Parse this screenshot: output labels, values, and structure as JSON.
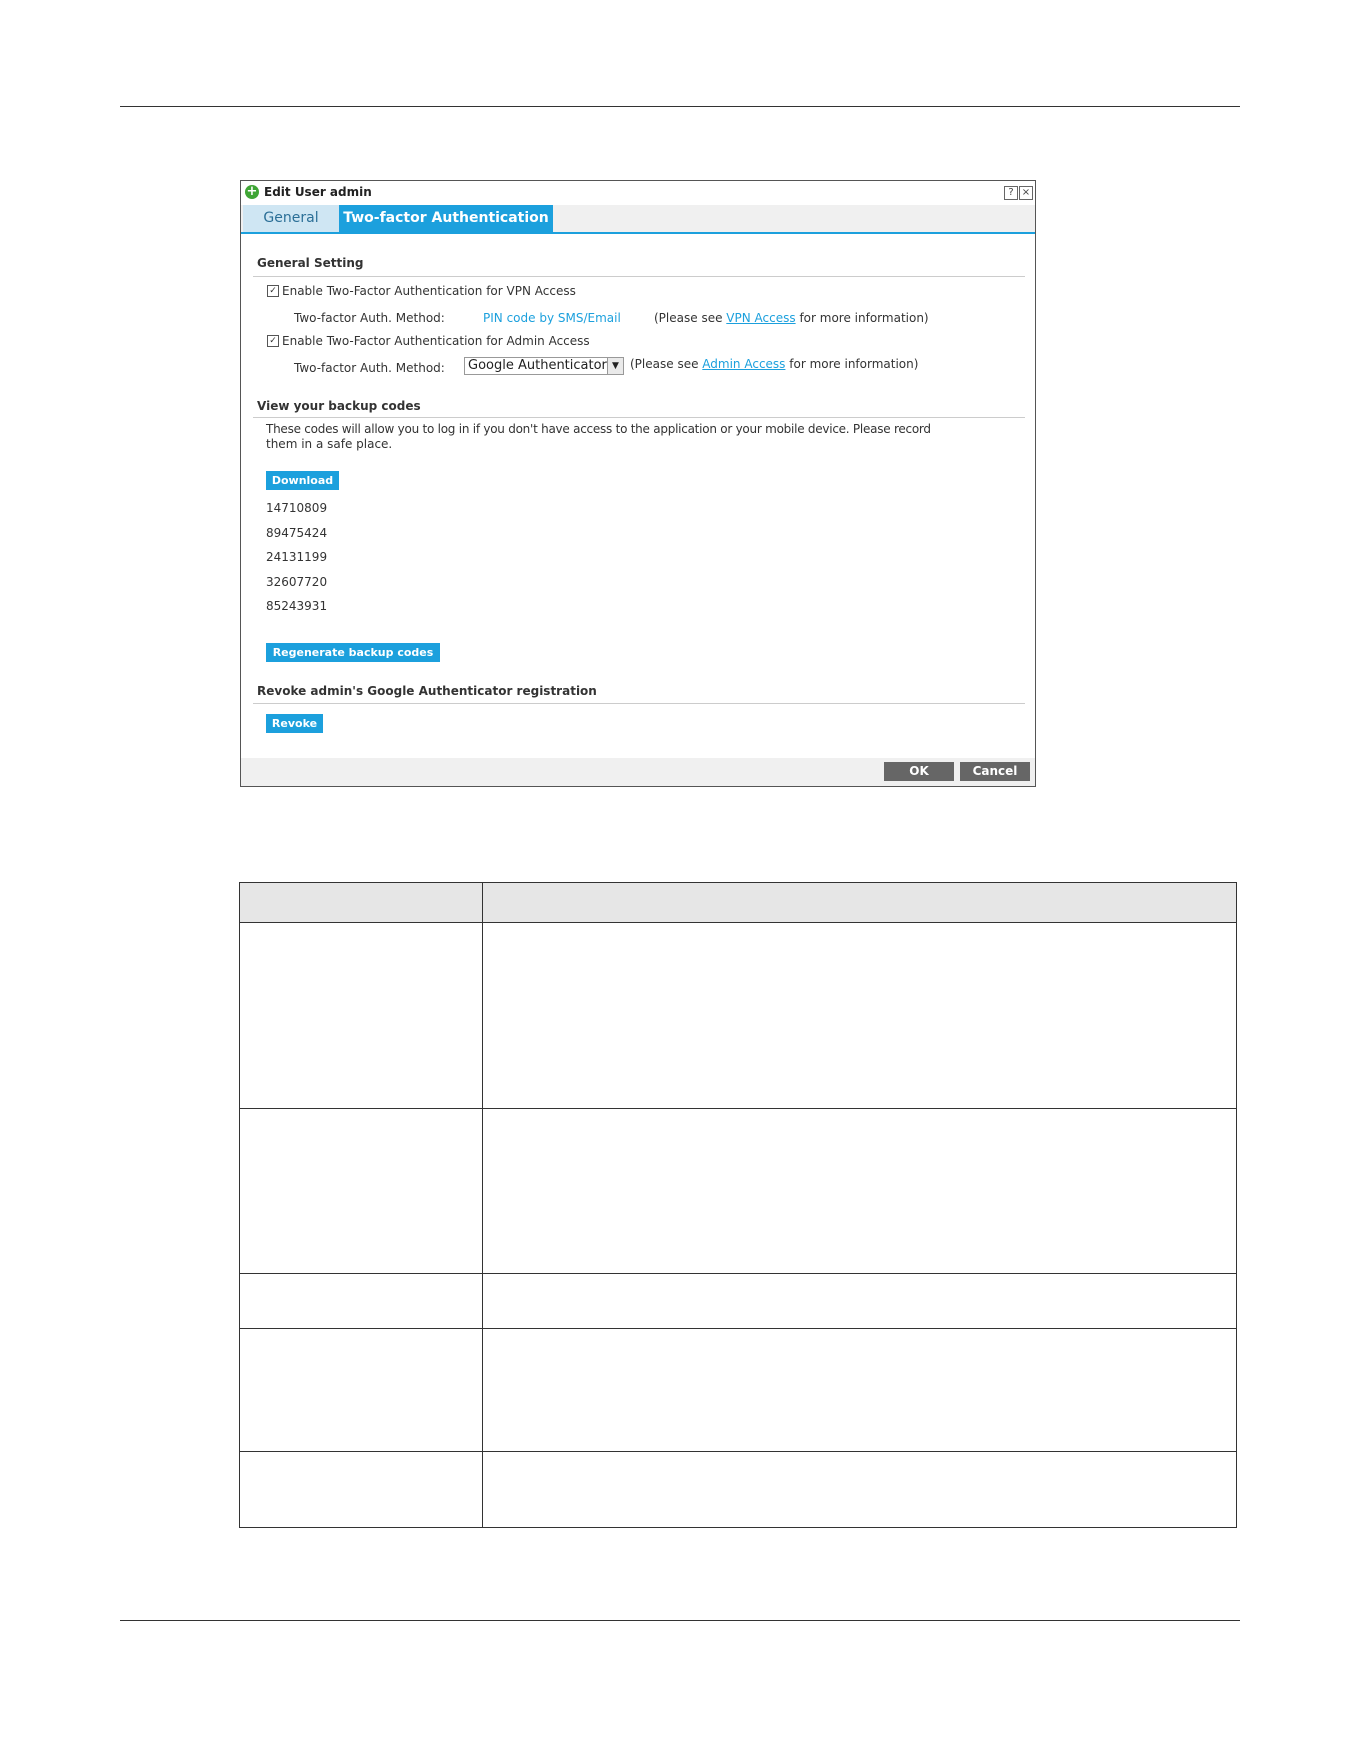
{
  "dialog": {
    "title": "Edit User admin",
    "help_label": "?",
    "close_label": "×",
    "tabs": [
      {
        "label": "General",
        "active": false
      },
      {
        "label": "Two-factor Authentication",
        "active": true
      }
    ],
    "general_setting": {
      "heading": "General Setting",
      "vpn_checkbox": {
        "checked": true,
        "label": "Enable Two-Factor Authentication for VPN Access"
      },
      "vpn_method": {
        "label": "Two-factor Auth. Method:",
        "value": "PIN code by SMS/Email",
        "note_prefix": "(Please see",
        "note_link": "VPN Access",
        "note_suffix": "for more information)"
      },
      "admin_checkbox": {
        "checked": true,
        "label": "Enable Two-Factor Authentication for Admin Access"
      },
      "admin_method": {
        "label": "Two-factor Auth. Method:",
        "selected": "Google Authenticator",
        "note_prefix": "(Please see",
        "note_link": "Admin Access",
        "note_suffix": "for more information)"
      }
    },
    "backup": {
      "heading": "View your backup codes",
      "description_line1": "These codes will allow you to log in if you don't have access to the application or your mobile device. Please record",
      "description_line2": "them in a safe place.",
      "download_label": "Download",
      "codes": [
        "14710809",
        "89475424",
        "24131199",
        "32607720",
        "85243931"
      ],
      "regenerate_label": "Regenerate backup codes"
    },
    "revoke": {
      "heading": "Revoke admin's Google Authenticator registration",
      "revoke_label": "Revoke"
    },
    "footer": {
      "ok_label": "OK",
      "cancel_label": "Cancel"
    }
  },
  "colors": {
    "accent": "#1ca0dd",
    "tab_inactive": "#cfe6f3",
    "button_grey": "#666666"
  }
}
